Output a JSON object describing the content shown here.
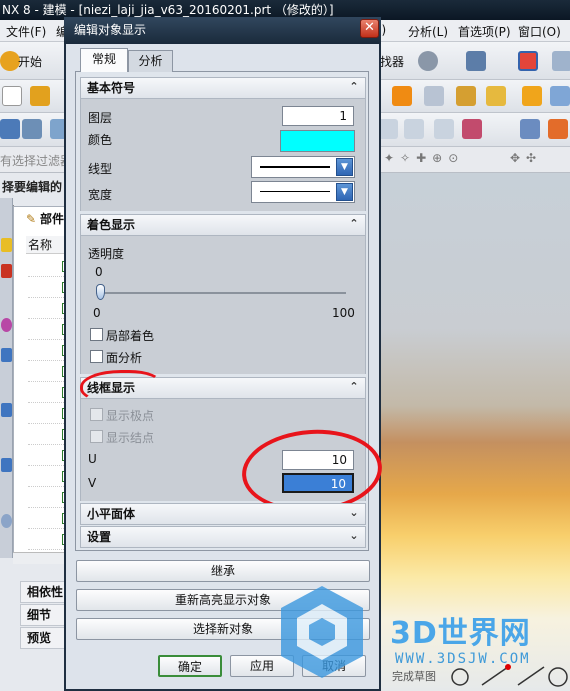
{
  "app": {
    "title": "NX 8 - 建模 - [niezi̇_laji_jia_v63_20160201.prt （修改的）]"
  },
  "menubar": {
    "file": "文件(F)",
    "edit": "编",
    "item_i": "I)",
    "analysis": "分析(L)",
    "preferences": "首选项(P)",
    "window": "窗口(O)"
  },
  "toolbar": {
    "start": "开始",
    "finder": "查找器"
  },
  "filterbar": {
    "text": "有选择过滤器"
  },
  "nav": {
    "heading": "择要编辑的对",
    "part_label": "部件",
    "col_name": "名称",
    "items": [
      "相依性",
      "细节",
      "预览"
    ]
  },
  "dialog": {
    "title": "编辑对象显示",
    "tabs": {
      "general": "常规",
      "analysis": "分析"
    },
    "basic": {
      "title": "基本符号",
      "layer_label": "图层",
      "layer_value": "1",
      "color_label": "颜色",
      "color_value": "#00ffff",
      "linetype_label": "线型",
      "width_label": "宽度"
    },
    "shading": {
      "title": "着色显示",
      "transparency_label": "透明度",
      "slider_value": "0",
      "slider_min": "0",
      "slider_max": "100",
      "partial_shade_label": "局部着色",
      "face_analysis_label": "面分析"
    },
    "wireframe": {
      "title": "线框显示",
      "show_poles_label": "显示极点",
      "show_knots_label": "显示结点",
      "u_label": "U",
      "u_value": "10",
      "v_label": "V",
      "v_value": "10"
    },
    "facet": {
      "title": "小平面体"
    },
    "settings": {
      "title": "设置"
    },
    "inherit_button": "继承",
    "rehighlight_button": "重新高亮显示对象",
    "select_new_button": "选择新对象",
    "ok_button": "确定",
    "apply_button": "应用",
    "cancel_button": "取消"
  },
  "watermark": {
    "brand": "3D世界网",
    "url": "WWW.3DSJW.COM"
  },
  "status": {
    "text": "完成草图"
  },
  "colors": {
    "accent": "#3b7fd6",
    "annotation": "#e8141b",
    "color_swatch": "#00ffff"
  }
}
